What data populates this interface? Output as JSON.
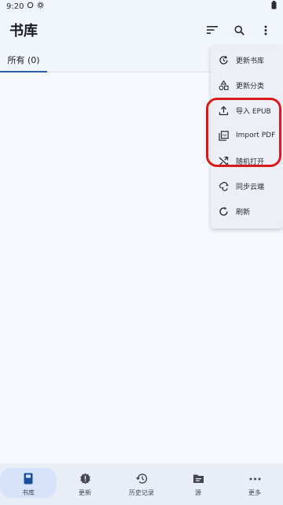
{
  "status": {
    "time": "9:20"
  },
  "app": {
    "title": "书库"
  },
  "tabs": [
    {
      "label": "所有 (0)",
      "active": true
    }
  ],
  "menu": {
    "items": [
      {
        "label": "更新书库",
        "icon": "refresh-clock-icon"
      },
      {
        "label": "更新分类",
        "icon": "shapes-icon"
      },
      {
        "label": "导入 EPUB",
        "icon": "upload-icon"
      },
      {
        "label": "Import PDF",
        "icon": "pdf-icon"
      },
      {
        "label": "随机打开",
        "icon": "shuffle-icon"
      },
      {
        "label": "同步云端",
        "icon": "cloud-sync-icon"
      },
      {
        "label": "刷新",
        "icon": "refresh-icon"
      }
    ]
  },
  "bottom_nav": [
    {
      "label": "书库",
      "icon": "book-icon",
      "active": true
    },
    {
      "label": "更新",
      "icon": "new-badge-icon"
    },
    {
      "label": "历史记录",
      "icon": "history-icon"
    },
    {
      "label": "源",
      "icon": "source-icon"
    },
    {
      "label": "更多",
      "icon": "more-icon"
    }
  ],
  "colors": {
    "accent": "#2d5fa6",
    "highlight": "#d81b1b",
    "background": "#f1f5fc"
  }
}
